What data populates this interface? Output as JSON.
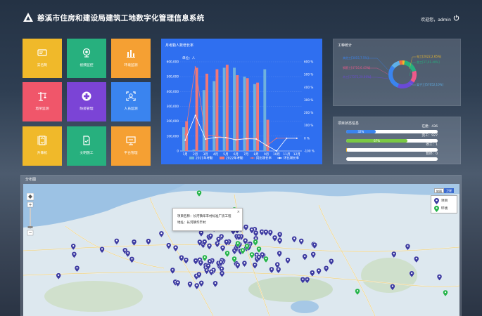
{
  "header": {
    "title": "慈溪市住房和建设局建筑工地数字化管理信息系统",
    "welcome": "欢迎您，",
    "user": "admin"
  },
  "tiles": [
    {
      "label": "实名制",
      "color": "#f0b92a",
      "icon": "id-card-icon"
    },
    {
      "label": "视频监控",
      "color": "#27b07e",
      "icon": "camera-icon"
    },
    {
      "label": "环境监测",
      "color": "#f5a033",
      "icon": "bar-chart-icon"
    },
    {
      "label": "塔吊监测",
      "color": "#f0566a",
      "icon": "tower-crane-icon"
    },
    {
      "label": "防疫管理",
      "color": "#7b44d6",
      "icon": "medical-cross-icon"
    },
    {
      "label": "人员监测",
      "color": "#3a84ef",
      "icon": "face-scan-icon"
    },
    {
      "label": "升降机",
      "color": "#f0b92a",
      "icon": "elevator-icon"
    },
    {
      "label": "文明施工",
      "color": "#27b07e",
      "icon": "document-check-icon"
    },
    {
      "label": "平台管理",
      "color": "#f5a033",
      "icon": "monitor-icon"
    }
  ],
  "chart_data": {
    "type": "bar",
    "title": "月考勤人数增长率",
    "ylabel": "单位：人",
    "categories": [
      "1月",
      "2月",
      "3月",
      "4月",
      "5月",
      "6月",
      "7月",
      "8月",
      "9月",
      "10月",
      "11月",
      "12月"
    ],
    "ylim": [
      0,
      600000
    ],
    "y_ticks": [
      "0",
      "100,000",
      "200,000",
      "300,000",
      "400,000",
      "500,000",
      "600,000"
    ],
    "y2lim": [
      -100,
      600
    ],
    "y2_ticks": [
      "-100 %",
      "0 %",
      "100 %",
      "200 %",
      "300 %",
      "400 %",
      "500 %",
      "600 %"
    ],
    "series": [
      {
        "name": "2021年考勤",
        "kind": "bar",
        "color": "#6fb1de",
        "values": [
          160000,
          10000,
          410000,
          470000,
          560000,
          560000,
          500000,
          450000,
          550000,
          0,
          0,
          0
        ]
      },
      {
        "name": "2022年考勤",
        "kind": "bar",
        "color": "#f07878",
        "values": [
          200000,
          560000,
          520000,
          550000,
          580000,
          510000,
          490000,
          460000,
          210000,
          0,
          0,
          0
        ]
      },
      {
        "name": "同比增长率",
        "kind": "line",
        "color": "#f07878",
        "values": [
          28,
          560,
          27,
          17,
          4,
          -9,
          -2,
          2,
          -62,
          0,
          0,
          0
        ]
      },
      {
        "name": "环比增长率",
        "kind": "line",
        "color": "#ffffff",
        "values": [
          -15,
          180,
          -7,
          6,
          5,
          -12,
          -4,
          -6,
          -55,
          -100,
          0,
          0
        ]
      }
    ]
  },
  "worker_panel": {
    "title": "工种统计",
    "donut": [
      {
        "label": "电工[2022,2.65%]",
        "color": "#f0b92a",
        "value": 2.65
      },
      {
        "label": "普工[37,91.40%]",
        "color": "#27b07e",
        "value": 18
      },
      {
        "label": "钢筋工[4716,6.43%]",
        "color": "#ee5a8a",
        "value": 14
      },
      {
        "label": "木工[17372,20.86%]",
        "color": "#6a4ad6",
        "value": 20.86
      },
      {
        "label": "其他[-]",
        "color": "#3a84ef",
        "value": 30
      },
      {
        "label": "架子工[57052,10%]",
        "color": "#5fb0e8",
        "value": 10
      },
      {
        "label": "",
        "color": "#f07040",
        "value": 4
      }
    ],
    "left_labels": [
      "其他工[3015,7.5%]",
      "钢筋工[4716,6.43%]",
      "木工[17372,20.86%]"
    ],
    "right_labels": [
      "电工[2022,2.65%]",
      "普工[37,91.40%]",
      "架子工[57052,10%]"
    ]
  },
  "status_panel": {
    "title": "项目状态信息",
    "rows": [
      {
        "name": "在建：436",
        "percent": 32,
        "pct_label": "32%",
        "color": "#3a84ef"
      },
      {
        "name": "完工：927",
        "percent": 67,
        "pct_label": "67%",
        "color": "#7ac943"
      },
      {
        "name": "停工：1",
        "percent": 1,
        "pct_label": "",
        "color": "#f0b92a"
      },
      {
        "name": "暂停：0",
        "percent": 0,
        "pct_label": "",
        "color": "#f0566a"
      }
    ]
  },
  "map": {
    "title": "分布图",
    "popup_name_label": "项目名称：",
    "popup_name": "长河镇华丰村标准厂房工程",
    "popup_addr_label": "地址：",
    "popup_addr": "长河镇华丰村",
    "btn_map": "地图",
    "btn_satellite": "卫星",
    "legend": [
      "项目",
      "环境"
    ],
    "project_color": "#3b3aa0",
    "env_color": "#25b34b"
  }
}
